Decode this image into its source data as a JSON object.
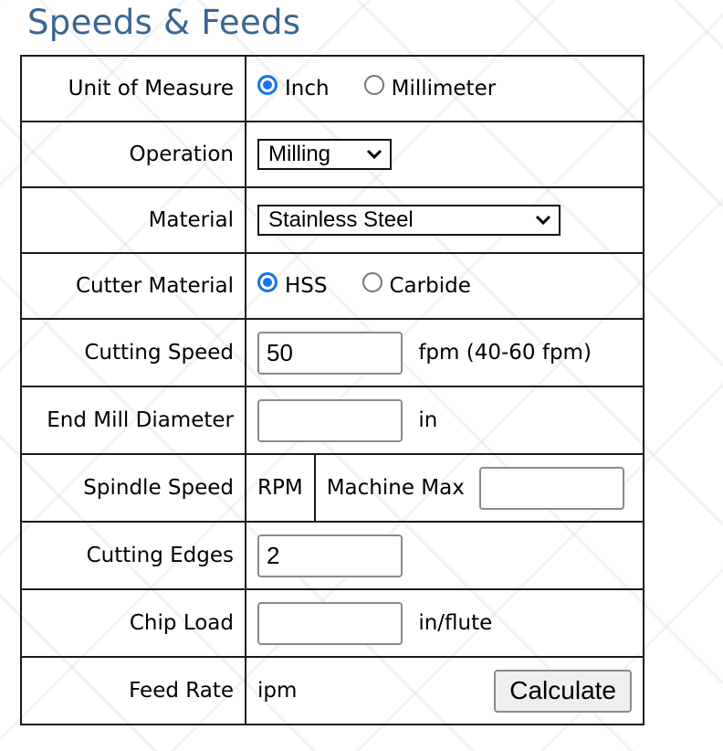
{
  "page": {
    "title": "Speeds & Feeds"
  },
  "colors": {
    "title": "#3b6592",
    "radio_checked": "#1a73e8"
  },
  "form": {
    "unit_of_measure": {
      "label": "Unit of Measure",
      "options": [
        {
          "label": "Inch",
          "checked": true
        },
        {
          "label": "Millimeter",
          "checked": false
        }
      ]
    },
    "operation": {
      "label": "Operation",
      "selected": "Milling"
    },
    "material": {
      "label": "Material",
      "selected": "Stainless Steel"
    },
    "cutter_material": {
      "label": "Cutter Material",
      "options": [
        {
          "label": "HSS",
          "checked": true
        },
        {
          "label": "Carbide",
          "checked": false
        }
      ]
    },
    "cutting_speed": {
      "label": "Cutting Speed",
      "value": "50",
      "unit": "fpm (40-60 fpm)"
    },
    "end_mill_diameter": {
      "label": "End Mill Diameter",
      "value": "",
      "unit": "in"
    },
    "spindle_speed": {
      "label": "Spindle Speed",
      "unit": "RPM",
      "machine_max_label": "Machine Max",
      "machine_max_value": ""
    },
    "cutting_edges": {
      "label": "Cutting Edges",
      "value": "2"
    },
    "chip_load": {
      "label": "Chip Load",
      "value": "",
      "unit": "in/flute"
    },
    "feed_rate": {
      "label": "Feed Rate",
      "unit": "ipm",
      "button": "Calculate"
    }
  }
}
